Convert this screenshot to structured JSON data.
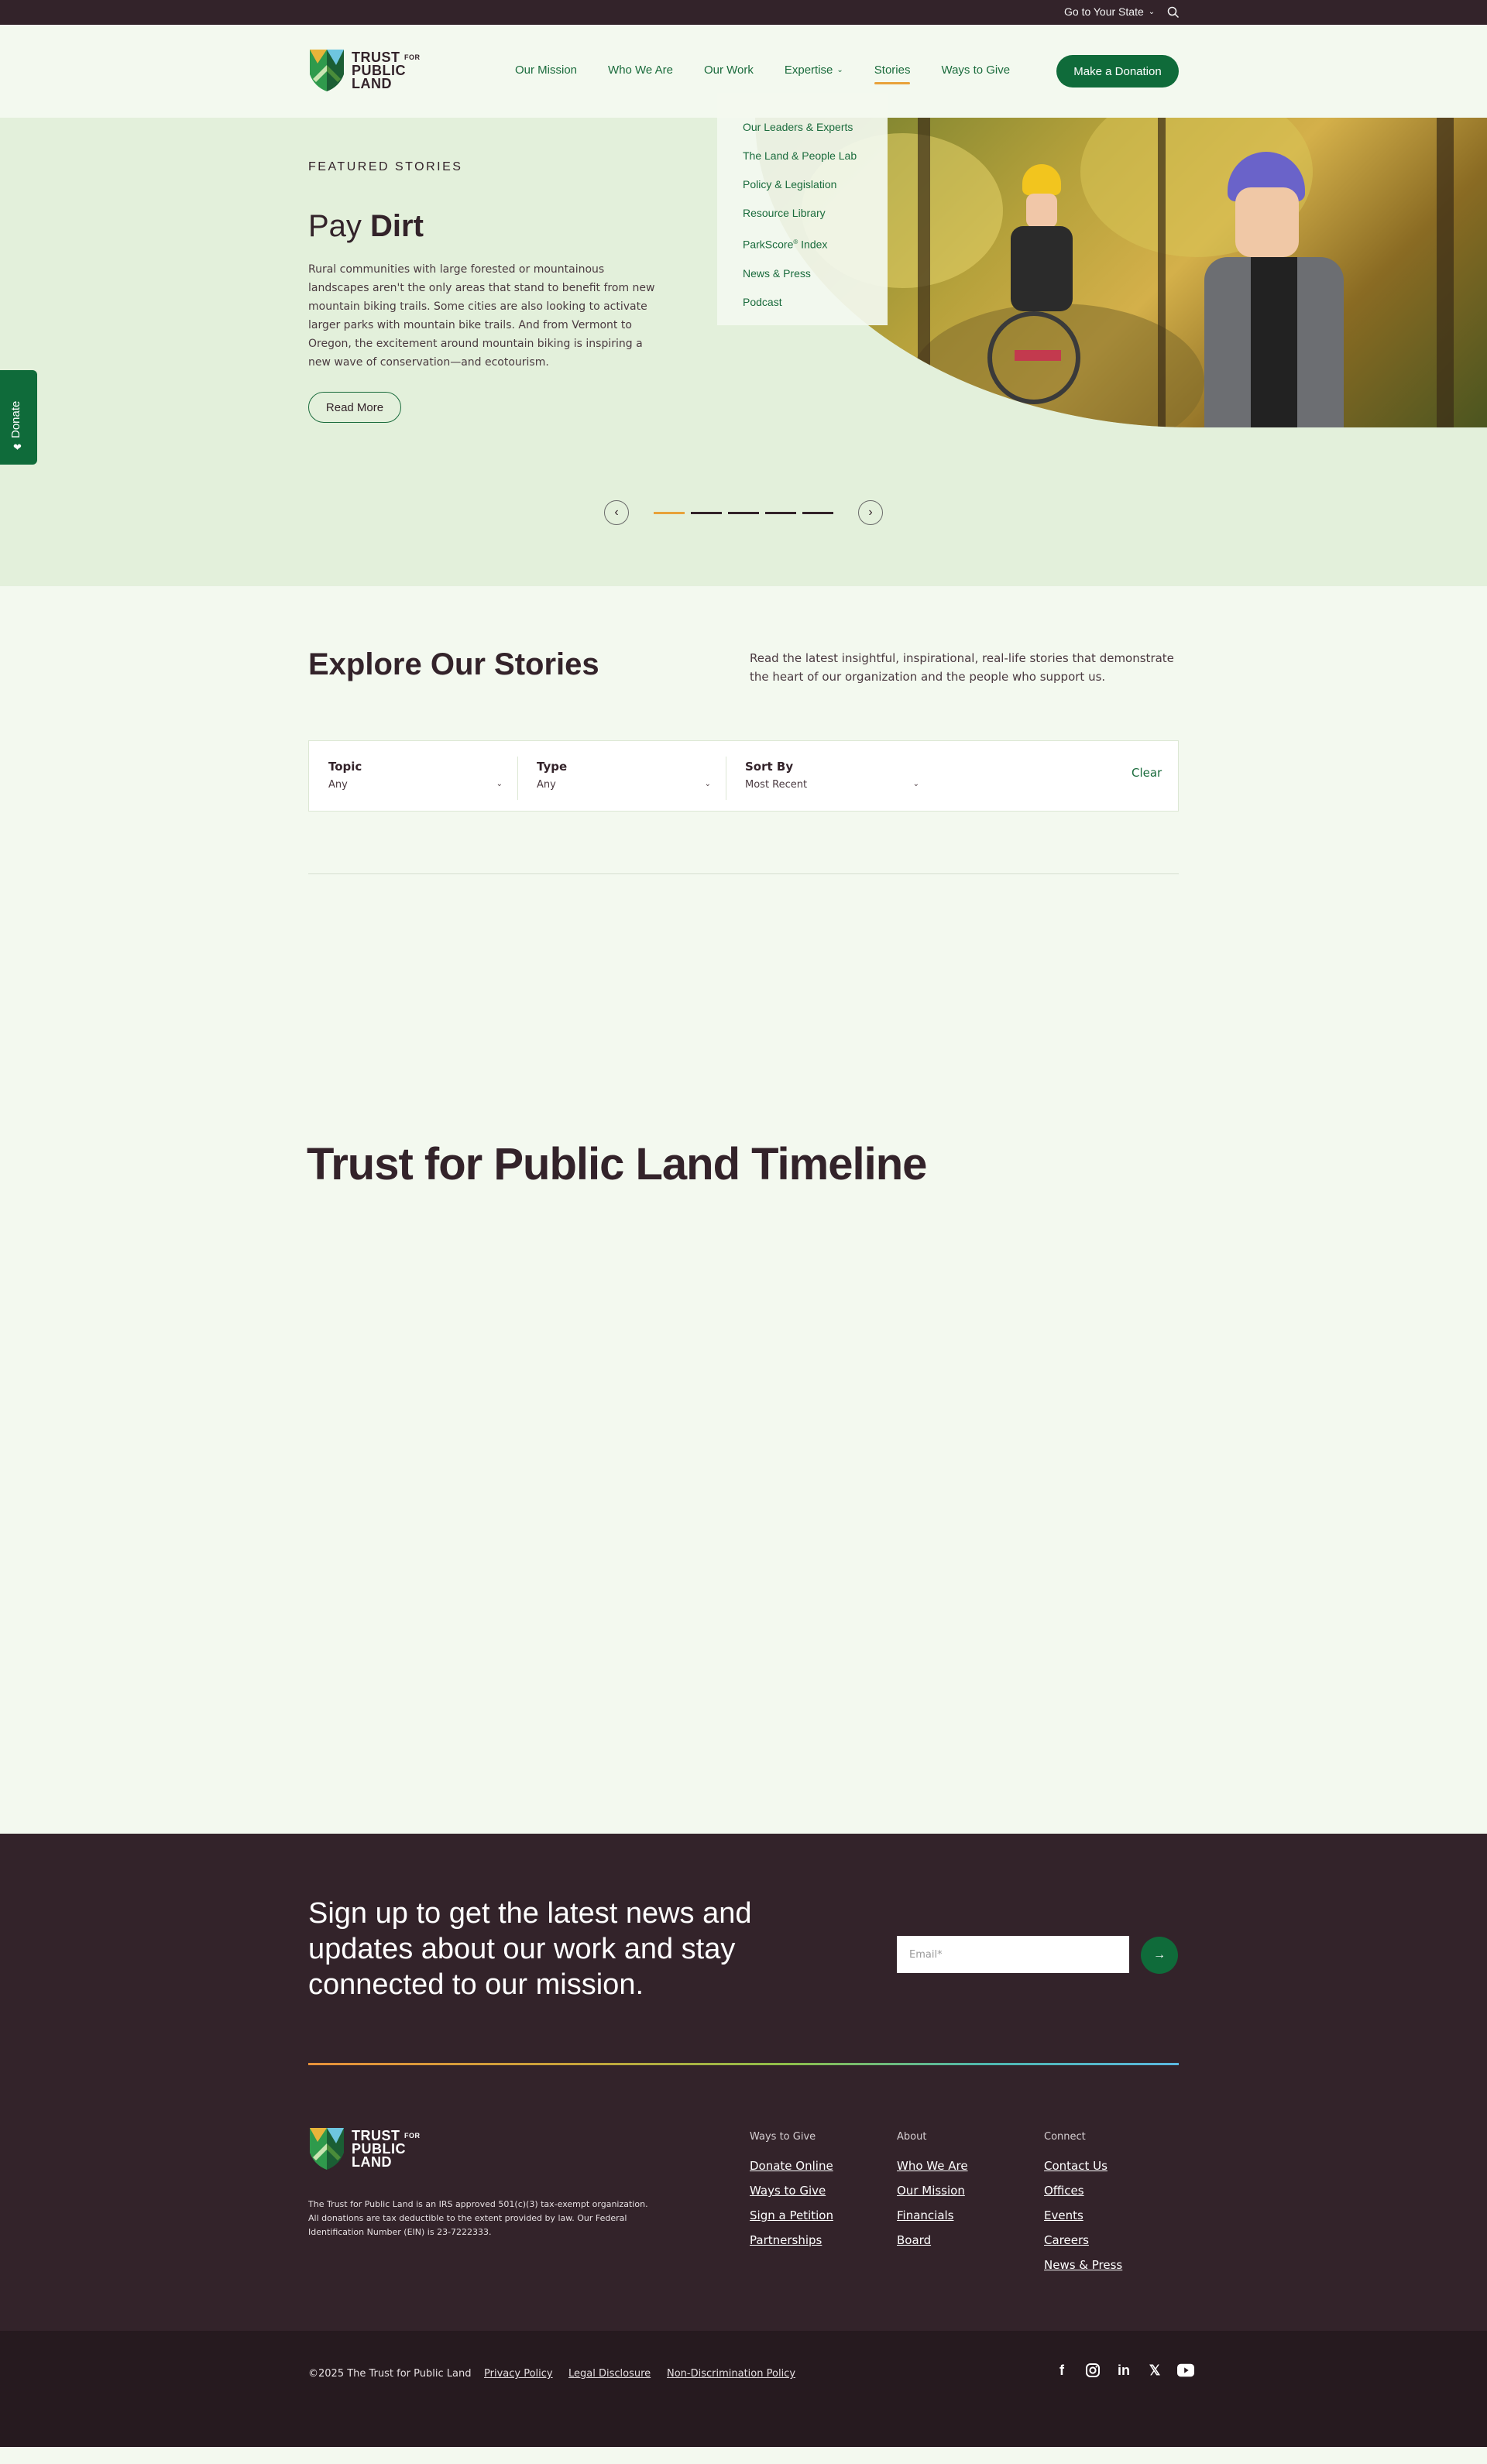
{
  "utility": {
    "state_label": "Go to Your State"
  },
  "header": {
    "logo": {
      "line1": "TRUST",
      "for": "FOR",
      "line2": "PUBLIC",
      "line3": "LAND"
    },
    "nav": [
      {
        "label": "Our Mission"
      },
      {
        "label": "Who We Are"
      },
      {
        "label": "Our Work"
      },
      {
        "label": "Expertise"
      },
      {
        "label": "Stories"
      },
      {
        "label": "Ways to Give"
      }
    ],
    "donate_label": "Make a Donation"
  },
  "dropdown": {
    "items": [
      "Our Leaders & Experts",
      "The Land & People Lab",
      "Policy & Legislation",
      "Resource Library",
      "ParkScore",
      "News & Press",
      "Podcast"
    ],
    "parkscore_suffix": " Index",
    "parkscore_mark": "®"
  },
  "side_donate": {
    "label": "Donate"
  },
  "hero": {
    "eyebrow": "FEATURED STORIES",
    "title_light": "Pay ",
    "title_bold": "Dirt",
    "body": "Rural communities with large forested or mountainous landscapes aren't the only areas that stand to benefit from new mountain biking trails. Some cities are also looking to activate larger parks with mountain bike trails. And from Vermont to Oregon, the excitement around mountain biking is inspiring a new wave of conservation—and ecotourism.",
    "cta_label": "Read More",
    "carousel": {
      "slides": 5,
      "active": 0
    }
  },
  "explore": {
    "title": "Explore Our Stories",
    "description": "Read the latest insightful, inspirational, real-life stories that demonstrate the heart of our organization and the people who support us.",
    "filters": [
      {
        "label": "Topic",
        "value": "Any"
      },
      {
        "label": "Type",
        "value": "Any"
      },
      {
        "label": "Sort By",
        "value": "Most Recent"
      }
    ],
    "clear_label": "Clear"
  },
  "timeline": {
    "title": "Trust for Public Land Timeline"
  },
  "footer": {
    "signup_title": "Sign up to get the latest news and updates about our work and stay connected to our mission.",
    "email_placeholder": "Email*",
    "disclaimer": "The Trust for Public Land is an IRS approved 501(c)(3) tax-exempt organization. All donations are tax deductible to the extent provided by law. Our Federal Identification Number (EIN) is 23-7222333.",
    "columns": [
      {
        "heading": "Ways to Give",
        "links": [
          "Donate Online",
          "Ways to Give",
          "Sign a Petition",
          "Partnerships"
        ]
      },
      {
        "heading": "About",
        "links": [
          "Who We Are",
          "Our Mission",
          "Financials",
          "Board"
        ]
      },
      {
        "heading": "Connect",
        "links": [
          "Contact Us",
          "Offices",
          "Events",
          "Careers",
          "News & Press"
        ]
      }
    ],
    "copyright": "©2025 The Trust for Public Land",
    "legal_links": [
      "Privacy Policy",
      "Legal Disclosure",
      "Non-Discrimination Policy"
    ],
    "social": [
      "facebook-icon",
      "instagram-icon",
      "linkedin-icon",
      "x-icon",
      "youtube-icon"
    ]
  },
  "colors": {
    "brand_green": "#0f6b3a",
    "accent_orange": "#e8a23a",
    "dark_plum": "#33232a",
    "page_bg": "#f3f9ef",
    "hero_bg": "#e3f0db"
  }
}
